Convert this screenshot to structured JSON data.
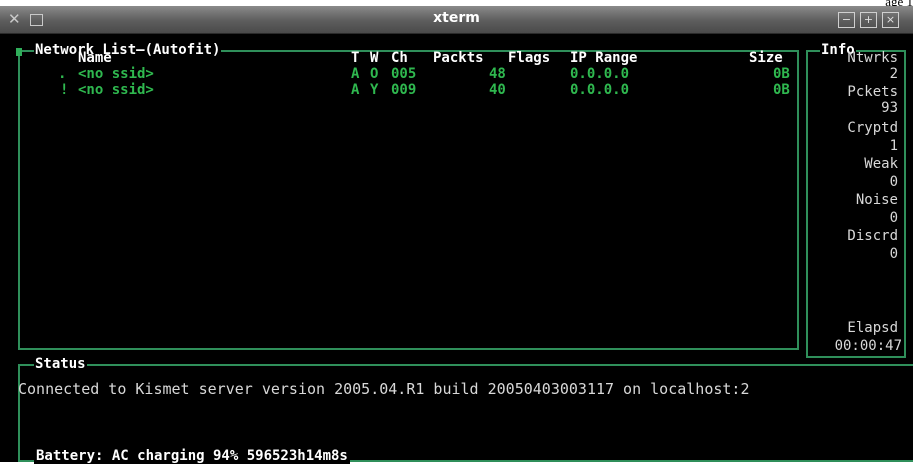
{
  "page": {
    "corner_text": "age 1"
  },
  "window": {
    "title": "xterm"
  },
  "network_list": {
    "title": "Network List—(Autofit)",
    "columns": [
      "Name",
      "T",
      "W",
      "Ch",
      "Packts",
      "Flags",
      "IP Range",
      "Size"
    ],
    "rows": [
      {
        "marker": ".",
        "name": "<no ssid>",
        "type": "A",
        "wep": "O",
        "channel": "005",
        "packets": "48",
        "flags": "",
        "ip_range": "0.0.0.0",
        "size": "0B"
      },
      {
        "marker": "!",
        "name": "<no ssid>",
        "type": "A",
        "wep": "Y",
        "channel": "009",
        "packets": "40",
        "flags": "",
        "ip_range": "0.0.0.0",
        "size": "0B"
      }
    ]
  },
  "info": {
    "title": "Info",
    "networks_label": "Ntwrks",
    "networks": "2",
    "packets_label": "Pckets",
    "packets": "93",
    "crypted_label": "Cryptd",
    "crypted": "1",
    "weak_label": "Weak",
    "weak": "0",
    "noise_label": "Noise",
    "noise": "0",
    "discarded_label": "Discrd",
    "discarded": "0",
    "elapsed_label": "Elapsd",
    "elapsed": "00:00:47"
  },
  "status": {
    "title": "Status",
    "message": "Connected to Kismet server version 2005.04.R1 build 20050403003117 on localhost:2",
    "battery": "Battery: AC charging 94% 596523h14m8s"
  }
}
